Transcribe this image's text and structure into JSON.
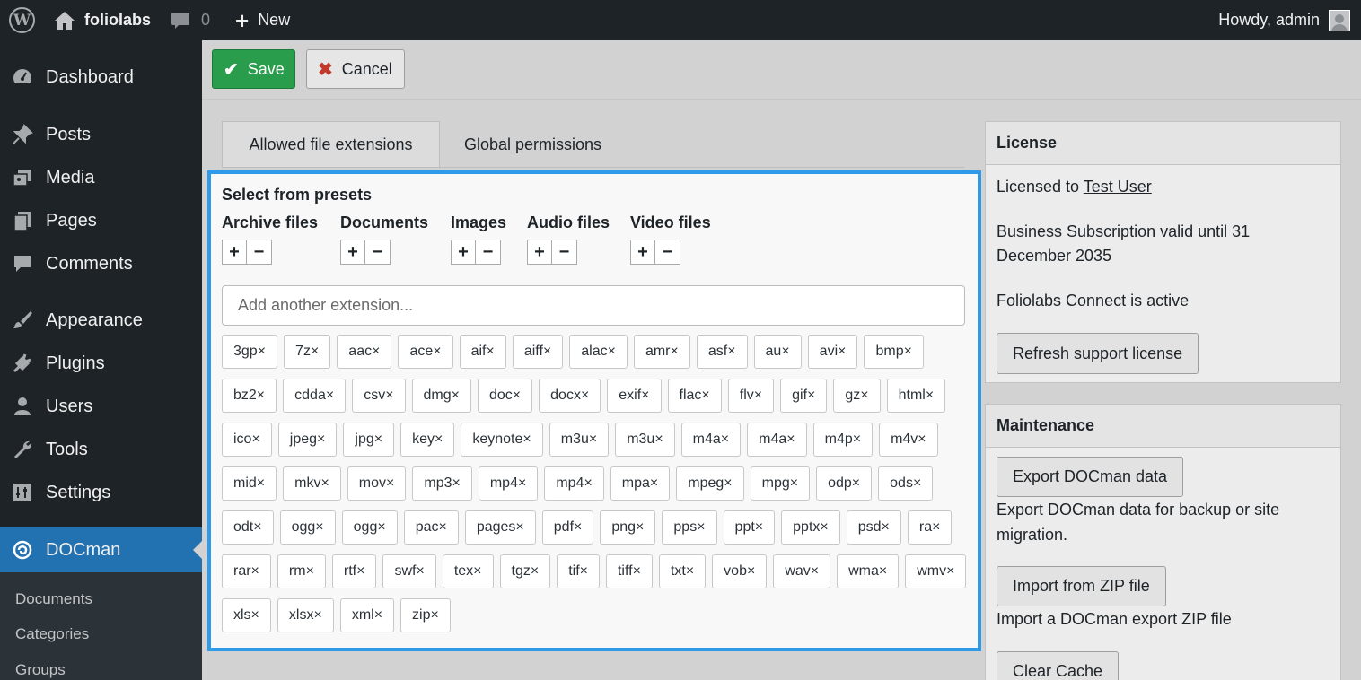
{
  "adminbar": {
    "site_name": "foliolabs",
    "comments_count": "0",
    "new_label": "New",
    "howdy": "Howdy, admin"
  },
  "sidebar": {
    "items": [
      {
        "label": "Dashboard",
        "icon": "dashboard-icon"
      },
      {
        "label": "Posts",
        "icon": "pin-icon"
      },
      {
        "label": "Media",
        "icon": "media-icon"
      },
      {
        "label": "Pages",
        "icon": "pages-icon"
      },
      {
        "label": "Comments",
        "icon": "comment-icon"
      },
      {
        "label": "Appearance",
        "icon": "brush-icon"
      },
      {
        "label": "Plugins",
        "icon": "plug-icon"
      },
      {
        "label": "Users",
        "icon": "user-icon"
      },
      {
        "label": "Tools",
        "icon": "wrench-icon"
      },
      {
        "label": "Settings",
        "icon": "settings-icon"
      },
      {
        "label": "DOCman",
        "icon": "docman-icon",
        "current": true
      }
    ],
    "submenu": [
      "Documents",
      "Categories",
      "Groups"
    ]
  },
  "toolbar": {
    "save_label": "Save",
    "cancel_label": "Cancel",
    "save_color": "#2a9d4d"
  },
  "tabs": {
    "active": "Allowed file extensions",
    "inactive": "Global permissions"
  },
  "extensions_panel": {
    "presets_title": "Select from presets",
    "presets": [
      "Archive files",
      "Documents",
      "Images",
      "Audio files",
      "Video files"
    ],
    "placeholder": "Add another extension...",
    "highlight_color": "#2f9ae8",
    "tags": [
      "3gp×",
      "7z×",
      "aac×",
      "ace×",
      "aif×",
      "aiff×",
      "alac×",
      "amr×",
      "asf×",
      "au×",
      "avi×",
      "bmp×",
      "bz2×",
      "cdda×",
      "csv×",
      "dmg×",
      "doc×",
      "docx×",
      "exif×",
      "flac×",
      "flv×",
      "gif×",
      "gz×",
      "html×",
      "ico×",
      "jpeg×",
      "jpg×",
      "key×",
      "keynote×",
      "m3u×",
      "m3u×",
      "m4a×",
      "m4a×",
      "m4p×",
      "m4v×",
      "mid×",
      "mkv×",
      "mov×",
      "mp3×",
      "mp4×",
      "mp4×",
      "mpa×",
      "mpeg×",
      "mpg×",
      "odp×",
      "ods×",
      "odt×",
      "ogg×",
      "ogg×",
      "pac×",
      "pages×",
      "pdf×",
      "png×",
      "pps×",
      "ppt×",
      "pptx×",
      "psd×",
      "ra×",
      "rar×",
      "rm×",
      "rtf×",
      "swf×",
      "tex×",
      "tgz×",
      "tif×",
      "tiff×",
      "txt×",
      "vob×",
      "wav×",
      "wma×",
      "wmv×",
      "xls×",
      "xlsx×",
      "xml×",
      "zip×"
    ]
  },
  "license": {
    "title": "License",
    "licensed_to_prefix": "Licensed to ",
    "licensed_to_user": "Test User",
    "subscription": "Business Subscription valid until 31 December 2035",
    "connect_status": "Foliolabs Connect is active",
    "refresh_button": "Refresh support license"
  },
  "maintenance": {
    "title": "Maintenance",
    "export_button": "Export DOCman data",
    "export_desc": "Export DOCman data for backup or site migration.",
    "import_button": "Import from ZIP file",
    "import_desc": "Import a DOCman export ZIP file",
    "clear_button": "Clear Cache"
  }
}
